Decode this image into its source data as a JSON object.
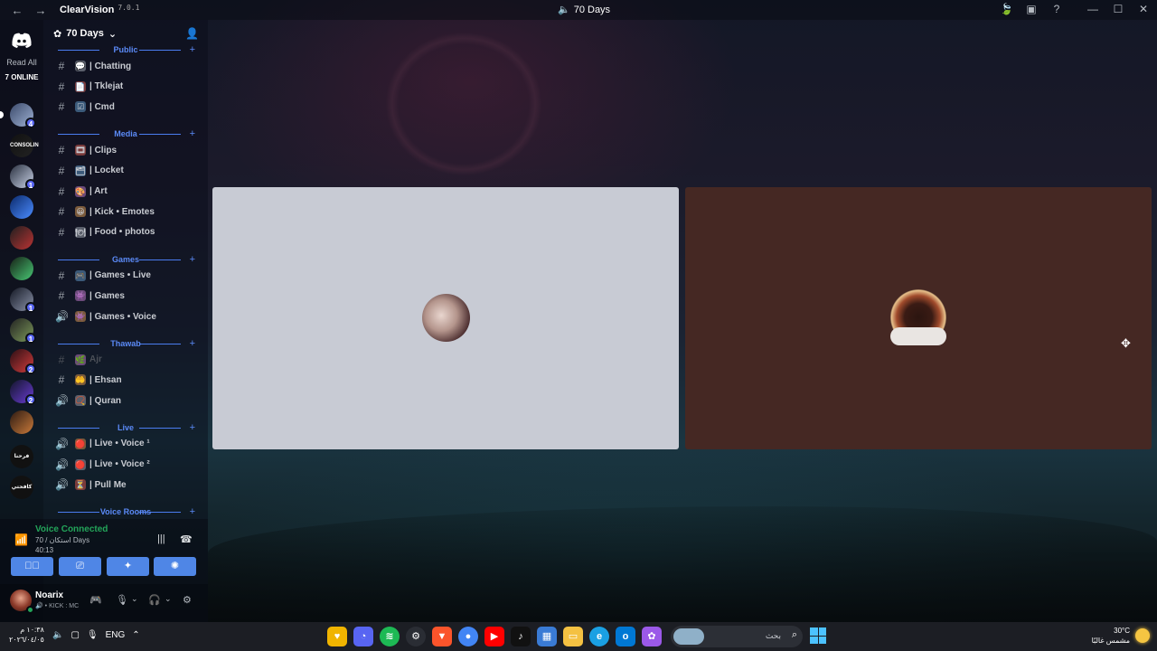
{
  "titlebar": {
    "back": "←",
    "forward": "→",
    "app_name": "ClearVision",
    "app_version": "7.0.1",
    "window_title": "70 Days",
    "window_title_icon": "speaker-icon",
    "controls": [
      "leaf-icon",
      "inbox-icon",
      "help-icon",
      "minimize-icon",
      "maximize-icon",
      "close-icon"
    ]
  },
  "rail": {
    "read_all": "Read All",
    "online": "7 ONLINE",
    "servers": [
      {
        "badge": "4",
        "colors": [
          "#3b4a6b",
          "#9fb1d3"
        ],
        "selected": true,
        "label": ""
      },
      {
        "badge": "",
        "colors": [
          "#111",
          "#222"
        ],
        "label": "CONSOLIN"
      },
      {
        "badge": "1",
        "colors": [
          "#2a3140",
          "#c9d2e6"
        ],
        "label": ""
      },
      {
        "badge": "",
        "colors": [
          "#0b2a6b",
          "#4b8cff"
        ],
        "label": ""
      },
      {
        "badge": "",
        "colors": [
          "#1f1f1f",
          "#b33"
        ],
        "label": ""
      },
      {
        "badge": "",
        "colors": [
          "#162016",
          "#48c774"
        ],
        "label": ""
      },
      {
        "badge": "1",
        "colors": [
          "#141824",
          "#8a92a8"
        ],
        "label": ""
      },
      {
        "badge": "1",
        "colors": [
          "#222",
          "#7d9a5a"
        ],
        "label": ""
      },
      {
        "badge": "2",
        "colors": [
          "#2a0f14",
          "#d23c3c"
        ],
        "label": ""
      },
      {
        "badge": "2",
        "colors": [
          "#12152a",
          "#6a3cd2"
        ],
        "label": ""
      },
      {
        "badge": "",
        "colors": [
          "#2b1a12",
          "#c97a3a"
        ],
        "label": ""
      },
      {
        "badge": "",
        "colors": [
          "#111",
          "#111"
        ],
        "label": "فرحنا"
      },
      {
        "badge": "",
        "colors": [
          "#111",
          "#111"
        ],
        "label": "كافحتي"
      }
    ]
  },
  "guild": {
    "name": "70 Days",
    "categories": [
      {
        "name": "Public",
        "channels": [
          {
            "type": "#",
            "emoji": "💬",
            "name": "| Chatting"
          },
          {
            "type": "#",
            "emoji": "📄",
            "name": "| Tklejat"
          },
          {
            "type": "#",
            "emoji": "☑",
            "name": "| Cmd"
          }
        ]
      },
      {
        "name": "Media",
        "channels": [
          {
            "type": "#",
            "emoji": "🎞",
            "name": "| Clips"
          },
          {
            "type": "#",
            "emoji": "🗂",
            "name": "| Locket"
          },
          {
            "type": "#",
            "emoji": "🎨",
            "name": "| Art"
          },
          {
            "type": "#",
            "emoji": "😀",
            "name": "| Kick • Emotes"
          },
          {
            "type": "#",
            "emoji": "🍽",
            "name": "| Food • photos"
          }
        ]
      },
      {
        "name": "Games",
        "channels": [
          {
            "type": "#",
            "emoji": "🎮",
            "name": "| Games • Live"
          },
          {
            "type": "#",
            "emoji": "👾",
            "name": "| Games"
          },
          {
            "type": "🔊",
            "emoji": "👾",
            "name": "| Games • Voice"
          }
        ]
      },
      {
        "name": "Thawab",
        "channels": [
          {
            "type": "#",
            "emoji": "🌿",
            "name": "Ajr",
            "muted": true
          },
          {
            "type": "#",
            "emoji": "🤲",
            "name": "| Ehsan"
          },
          {
            "type": "🔊",
            "emoji": "📿",
            "name": "| Quran"
          }
        ]
      },
      {
        "name": "Live",
        "channels": [
          {
            "type": "🔊",
            "emoji": "🔴",
            "name": "| Live • Voice ¹"
          },
          {
            "type": "🔊",
            "emoji": "🔴",
            "name": "| Live • Voice ²"
          },
          {
            "type": "🔊",
            "emoji": "⏳",
            "name": "| Pull Me"
          }
        ]
      },
      {
        "name": "Voice Rooms",
        "channels": []
      }
    ]
  },
  "voice": {
    "status": "Voice Connected",
    "room": "70 / استكان Days",
    "elapsed": "40:13",
    "buttons": [
      "camera-off-icon",
      "screen-share-icon",
      "activities-icon",
      "soundboard-icon"
    ]
  },
  "user": {
    "name": "Noarix",
    "subtitle": "KICK : MC"
  },
  "taskbar": {
    "time": "١٠:٣٨ م",
    "date": "٢٠٢٦/٠٤/٠٥",
    "language": "ENG",
    "search_placeholder": "بحث",
    "weather_temp": "30°C",
    "weather_desc": "مشمس غالبًا"
  }
}
